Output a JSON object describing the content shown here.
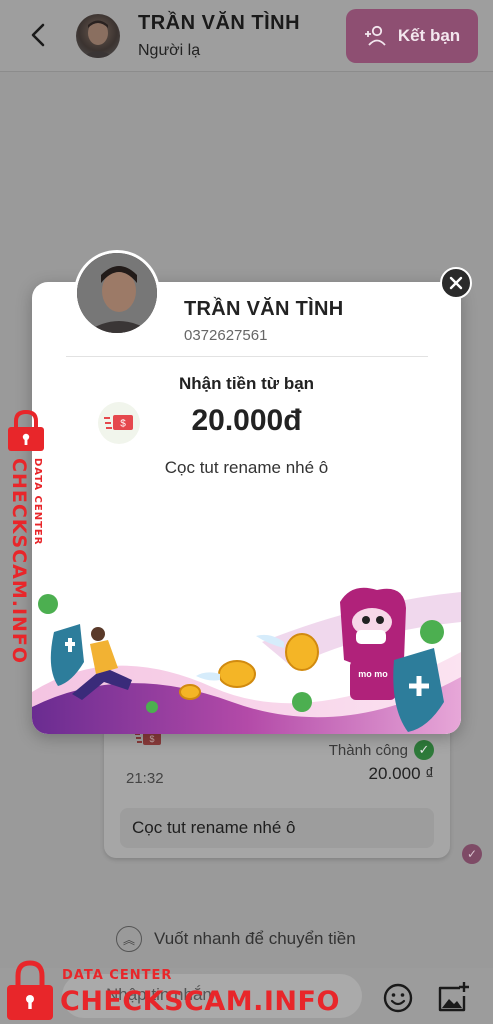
{
  "header": {
    "contact_name": "TRẦN VĂN TÌNH",
    "contact_status": "Người lạ",
    "add_friend_label": "Kết bạn"
  },
  "chat": {
    "transfer_card": {
      "status": "Thành công",
      "amount": "20.000 ₫",
      "time": "21:32",
      "message": "Cọc tut rename nhé ô"
    },
    "swipe_hint": "Vuốt nhanh để chuyển tiền"
  },
  "composer": {
    "placeholder": "Nhập tin nhắn"
  },
  "modal": {
    "name": "TRẦN VĂN TÌNH",
    "phone": "0372627561",
    "label": "Nhận tiền từ bạn",
    "amount": "20.000đ",
    "note": "Cọc tut rename nhé ô",
    "mascot_text": "mo mo"
  },
  "watermark": {
    "side_text": "CHECKSCAM.INFO",
    "side_sub": "DATA CENTER",
    "bottom_sub": "DATA CENTER",
    "bottom_text": "CHECKSCAM.INFO"
  },
  "colors": {
    "brand_pink": "#a50064",
    "watermark_red": "#e8262a",
    "success_green": "#2e7a3a"
  },
  "icons": [
    "back-arrow-icon",
    "add-person-icon",
    "money-transfer-icon",
    "check-circle-icon",
    "swipe-up-icon",
    "emoji-icon",
    "add-image-icon",
    "close-icon",
    "lock-icon"
  ]
}
